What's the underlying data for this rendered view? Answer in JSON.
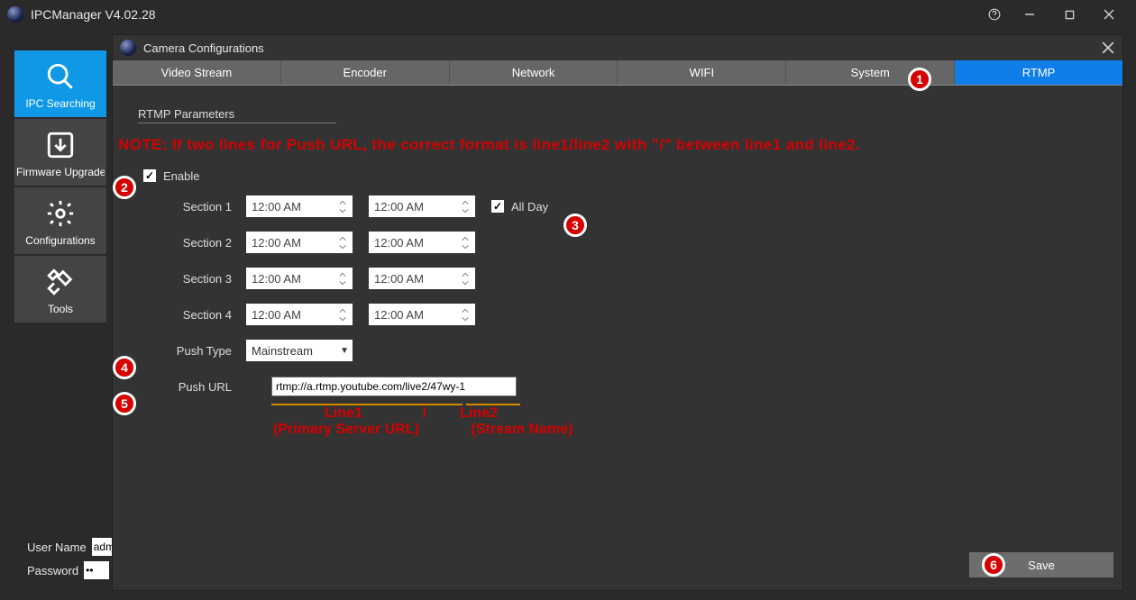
{
  "window": {
    "title": "IPCManager V4.02.28"
  },
  "sidebar": {
    "items": [
      {
        "label": "IPC Searching"
      },
      {
        "label": "Firmware Upgrade"
      },
      {
        "label": "Configurations"
      },
      {
        "label": "Tools"
      }
    ]
  },
  "credentials": {
    "user_label": "User Name",
    "user_value": "admin",
    "pass_label": "Password",
    "pass_value": "••"
  },
  "panel": {
    "title": "Camera Configurations",
    "tabs": [
      {
        "label": "Video Stream"
      },
      {
        "label": "Encoder"
      },
      {
        "label": "Network"
      },
      {
        "label": "WIFI"
      },
      {
        "label": "System"
      },
      {
        "label": "RTMP"
      }
    ],
    "active_tab": 5
  },
  "rtmp": {
    "section_title": "RTMP Parameters",
    "enable_label": "Enable",
    "enable_checked": true,
    "sections": [
      {
        "label": "Section 1",
        "start": "12:00 AM",
        "end": "12:00 AM"
      },
      {
        "label": "Section 2",
        "start": "12:00 AM",
        "end": "12:00 AM"
      },
      {
        "label": "Section 3",
        "start": "12:00 AM",
        "end": "12:00 AM"
      },
      {
        "label": "Section 4",
        "start": "12:00 AM",
        "end": "12:00 AM"
      }
    ],
    "all_day_label": "All Day",
    "all_day_checked": true,
    "push_type_label": "Push Type",
    "push_type_value": "Mainstream",
    "push_url_label": "Push URL",
    "push_url_value": "rtmp://a.rtmp.youtube.com/live2/47wy-1",
    "save_label": "Save"
  },
  "annotations": {
    "note": "NOTE: If two lines for Push URL, the correct format is line1/line2 with \"/\" between line1 and line2.",
    "line1": "Line1",
    "slash": "/",
    "line2": "Line2",
    "primary": "(Primary Server URL)",
    "stream": "(Stream Name)",
    "badges": [
      "1",
      "2",
      "3",
      "4",
      "5",
      "6"
    ]
  }
}
